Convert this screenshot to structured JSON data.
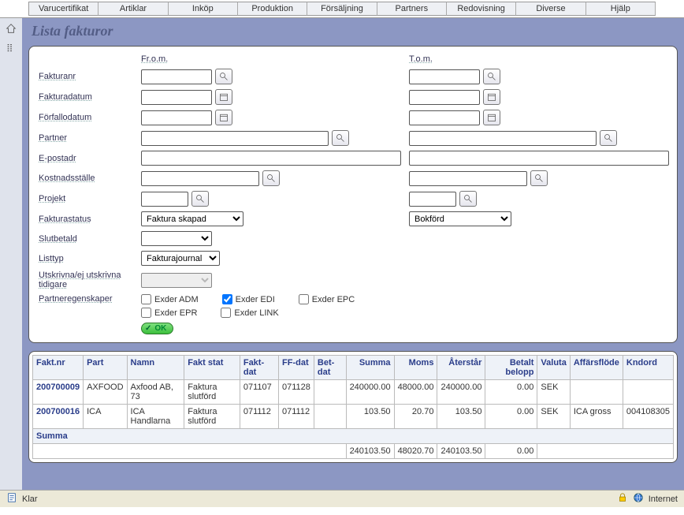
{
  "topmenu": [
    "Varucertifikat",
    "Artiklar",
    "Inköp",
    "Produktion",
    "Försäljning",
    "Partners",
    "Redovisning",
    "Diverse",
    "Hjälp"
  ],
  "title": "Lista fakturor",
  "form": {
    "from_header": "Fr.o.m.",
    "to_header": "T.o.m.",
    "labels": {
      "fakturanr": "Fakturanr",
      "fakturadatum": "Fakturadatum",
      "forfallodatum": "Förfallodatum",
      "partner": "Partner",
      "epostadr": "E-postadr",
      "kostnadsstalle": "Kostnadsställe",
      "projekt": "Projekt",
      "fakturastatus": "Fakturastatus",
      "slutbetald": "Slutbetald",
      "listtyp": "Listtyp",
      "utskrivna": "Utskrivna/ej utskrivna tidigare",
      "partneregenskaper": "Partneregenskaper"
    },
    "selects": {
      "fakturastatus_from": "Faktura skapad",
      "fakturastatus_to": "Bokförd",
      "listtyp": "Fakturajournal"
    },
    "checkboxes": {
      "exder_adm": "Exder ADM",
      "exder_edi": "Exder EDI",
      "exder_epc": "Exder EPC",
      "exder_epr": "Exder EPR",
      "exder_link": "Exder LINK"
    },
    "ok_label": "OK"
  },
  "table": {
    "headers": {
      "faktnr": "Fakt.nr",
      "part": "Part",
      "namn": "Namn",
      "faktstat": "Fakt stat",
      "faktdat": "Fakt-dat",
      "ffdat": "FF-dat",
      "betdat": "Bet-dat",
      "summa": "Summa",
      "moms": "Moms",
      "aterstar": "Återstår",
      "betaltbelopp": "Betalt belopp",
      "valuta": "Valuta",
      "affarsflode": "Affärsflöde",
      "kndord": "Kndord"
    },
    "rows": [
      {
        "faktnr": "200700009",
        "part": "AXFOOD",
        "namn": "Axfood AB, 73",
        "faktstat": "Faktura slutförd",
        "faktdat": "071107",
        "ffdat": "071128",
        "betdat": "",
        "summa": "240000.00",
        "moms": "48000.00",
        "aterstar": "240000.00",
        "betaltbelopp": "0.00",
        "valuta": "SEK",
        "affarsflode": "",
        "kndord": ""
      },
      {
        "faktnr": "200700016",
        "part": "ICA",
        "namn": "ICA Handlarna",
        "faktstat": "Faktura slutförd",
        "faktdat": "071112",
        "ffdat": "071112",
        "betdat": "",
        "summa": "103.50",
        "moms": "20.70",
        "aterstar": "103.50",
        "betaltbelopp": "0.00",
        "valuta": "SEK",
        "affarsflode": "ICA gross",
        "kndord": "004108305"
      }
    ],
    "summa_label": "Summa",
    "totals": {
      "summa": "240103.50",
      "moms": "48020.70",
      "aterstar": "240103.50",
      "betaltbelopp": "0.00"
    }
  },
  "statusbar": {
    "status": "Klar",
    "zone": "Internet"
  }
}
